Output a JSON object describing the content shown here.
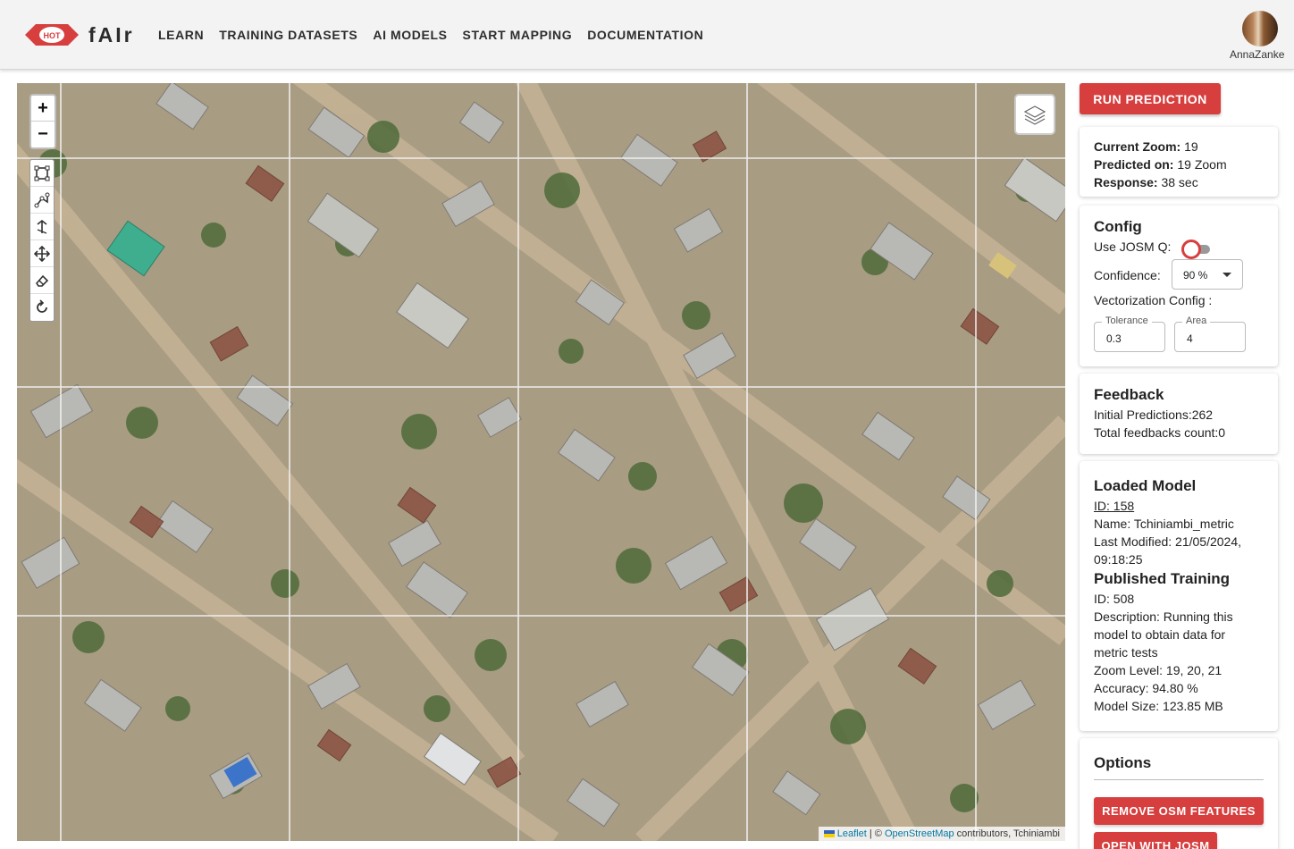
{
  "header": {
    "logo_text": "HOT",
    "brand": "fAIr",
    "nav": [
      "LEARN",
      "TRAINING DATASETS",
      "AI MODELS",
      "START MAPPING",
      "DOCUMENTATION"
    ],
    "username": "AnnaZanke"
  },
  "map": {
    "zoom_in": "+",
    "zoom_out": "−",
    "tools": [
      "draw-rectangle-icon",
      "edit-shape-icon",
      "cut-icon",
      "move-icon",
      "eraser-icon",
      "rotate-icon"
    ],
    "layers_icon": "layers-icon",
    "attribution": {
      "leaflet": "Leaflet",
      "sep": " | © ",
      "osm": "OpenStreetMap",
      "rest": " contributors, Tchiniambi"
    }
  },
  "panel": {
    "run_button": "RUN PREDICTION",
    "status": {
      "zoom_label": "Current Zoom:",
      "zoom_value": " 19",
      "predicted_label": "Predicted on:",
      "predicted_value": " 19 Zoom",
      "response_label": "Response:",
      "response_value": " 38 sec"
    },
    "config": {
      "title": "Config",
      "josm_label": "Use JOSM Q:",
      "josm_enabled": false,
      "confidence_label": "Confidence:",
      "confidence_value": "90 %",
      "vectorization_label": "Vectorization Config :",
      "tolerance_label": "Tolerance",
      "tolerance_value": "0.3",
      "area_label": "Area",
      "area_value": "4"
    },
    "feedback": {
      "title": "Feedback",
      "initial": "Initial Predictions:262",
      "total": "Total feedbacks count:0"
    },
    "model": {
      "title": "Loaded Model",
      "id": "ID: 158",
      "name": "Name: Tchiniambi_metric",
      "modified_1": "Last Modified: 21/05/2024,",
      "modified_2": "09:18:25",
      "training_title": "Published Training",
      "training_id": "ID: 508",
      "desc_1": "Description: Running this",
      "desc_2": "model to obtain data for",
      "desc_3": "metric tests",
      "zoom_levels": "Zoom Level: 19, 20, 21",
      "accuracy": "Accuracy: 94.80 %",
      "size": "Model Size: 123.85 MB"
    },
    "options": {
      "title": "Options",
      "remove_button": "REMOVE OSM FEATURES",
      "josm_button": "OPEN WITH JOSM"
    }
  },
  "colors": {
    "accent": "#d73f3f",
    "link": "#0078a8"
  }
}
